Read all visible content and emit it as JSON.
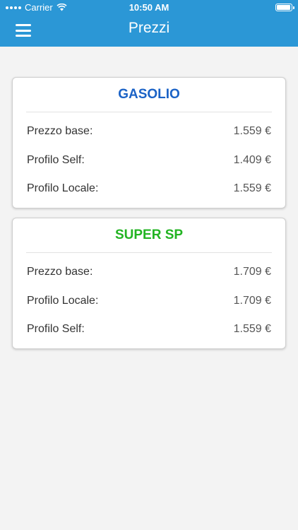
{
  "status_bar": {
    "carrier": "Carrier",
    "time": "10:50 AM",
    "battery_level": 0.95
  },
  "header": {
    "title": "Prezzi",
    "background_color": "#2b97d6",
    "menu_icon": "hamburger-menu-icon"
  },
  "cards": [
    {
      "title": "GASOLIO",
      "title_color": "#1a62c6",
      "rows": [
        {
          "label": "Prezzo base:",
          "value": "1.559 €"
        },
        {
          "label": "Profilo Self:",
          "value": "1.409 €"
        },
        {
          "label": "Profilo Locale:",
          "value": "1.559 €"
        }
      ]
    },
    {
      "title": "SUPER SP",
      "title_color": "#22b422",
      "rows": [
        {
          "label": "Prezzo base:",
          "value": "1.709 €"
        },
        {
          "label": "Profilo Locale:",
          "value": "1.709 €"
        },
        {
          "label": "Profilo Self:",
          "value": "1.559 €"
        }
      ]
    }
  ]
}
